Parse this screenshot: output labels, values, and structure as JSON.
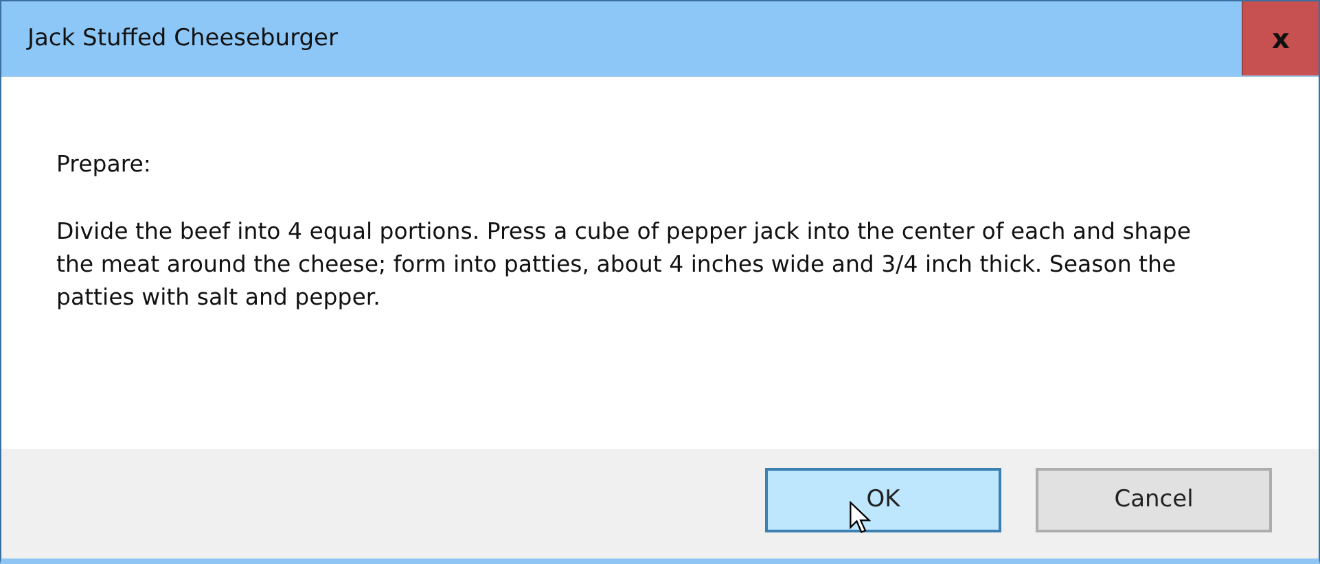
{
  "window": {
    "title": "Jack Stuffed Cheeseburger",
    "close": "x"
  },
  "message": {
    "heading": "Prepare:",
    "body": "Divide the beef into 4 equal portions. Press a cube of pepper jack into the center of each and shape the meat around the cheese; form into patties, about 4 inches wide and 3/4 inch thick. Season the patties with salt and pepper."
  },
  "buttons": [
    {
      "label": "OK",
      "hovered": true
    },
    {
      "label": "Cancel",
      "hovered": false
    }
  ]
}
